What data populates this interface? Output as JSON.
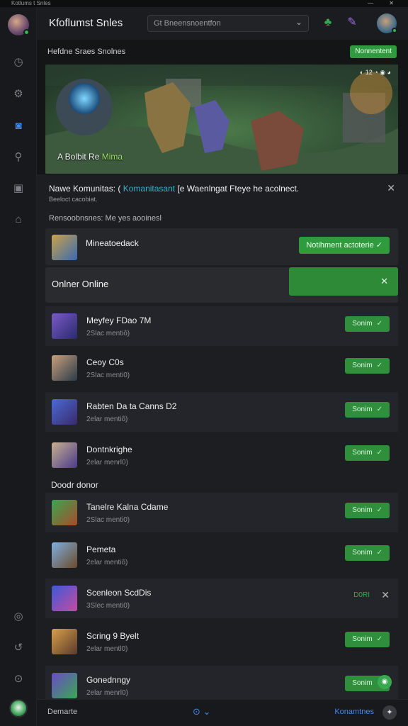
{
  "window": {
    "title": "Kotlums t Snles",
    "controls": "— ✕"
  },
  "header": {
    "title": "Kfoflumst Snles",
    "search_placeholder": "Gt Bneensnoentfon",
    "icons": [
      "leaf-icon",
      "wand-icon"
    ]
  },
  "sidebar": {
    "icons": [
      "clock-icon",
      "gamepad-icon",
      "chat-active-icon",
      "search-icon",
      "screen-icon",
      "alert-icon",
      "settings-icon",
      "back-icon",
      "help-icon"
    ]
  },
  "main": {
    "section_label": "Hefdne Sraes Snolnes",
    "top_pill": "Nonnentent",
    "banner": {
      "caption_pre": "A Bolbit Re",
      "caption_hl": "Mima",
      "stats": "◐ 12 ◔ ◉ ◕"
    }
  },
  "panel": {
    "title_pre": "Nawe Komunitas: (",
    "title_blue": "Komanitasant",
    "title_post": "[e Waenlngat Fteye he acolnect.",
    "subtitle": "Beeloct cacobiat.",
    "label": "Rensoobnsnes: Me yes aooinesl",
    "first_row": {
      "name": "Mineatoedack",
      "button": "Notihment actoterie",
      "check": "✓"
    },
    "online": {
      "label": "Onlner Online",
      "close": "✕"
    },
    "group_label": "Doodr donor",
    "button_default": "Sonim",
    "rows_a": [
      {
        "name": "Meyfey FDao 7M",
        "sub": "2Slac mentiô)"
      },
      {
        "name": "Ceoy C0s",
        "sub": "2Slac menti0)"
      },
      {
        "name": "Rabten Da ta Canns D2",
        "sub": "2elar mentiô)"
      },
      {
        "name": "Dontnkrighe",
        "sub": "2elar menrl0)"
      }
    ],
    "rows_b": [
      {
        "name": "Tanelre Kalna Cdame",
        "sub": "2Slac menti0)",
        "kind": "button"
      },
      {
        "name": "Pemeta",
        "sub": "2elar mentiô)",
        "kind": "button"
      },
      {
        "name": "Scenleon ScdDis",
        "sub": "3Slec menti0)",
        "kind": "text",
        "text_btn": "D0RI"
      },
      {
        "name": "Scring 9 Byelt",
        "sub": "2elar mentl0)",
        "kind": "button"
      },
      {
        "name": "Gonednngy",
        "sub": "2elar menrl0)",
        "kind": "button"
      }
    ]
  },
  "footer": {
    "left": "Demarte",
    "mid": "⊙ ⌄",
    "right": "Konamtnes",
    "help": "✦"
  },
  "colors": {
    "accent_green": "#2f9a3e",
    "accent_blue": "#3d8bf0",
    "panel_bg": "#1d1e21"
  }
}
